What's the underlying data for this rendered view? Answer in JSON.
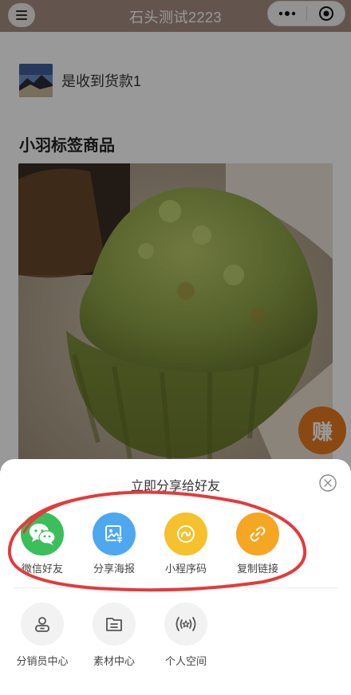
{
  "nav": {
    "title": "石头测试2223",
    "menu_icon": "menu-icon",
    "more_icon": "more-dots-icon",
    "close_icon": "target-close-icon"
  },
  "order": {
    "text": "是收到货款1"
  },
  "product": {
    "title": "小羽标签商品"
  },
  "earn_badge": "赚",
  "share_sheet": {
    "title": "立即分享给好友",
    "share_items": [
      {
        "label": "微信好友",
        "icon": "wechat-icon",
        "color": "#3bbf5a"
      },
      {
        "label": "分享海报",
        "icon": "poster-icon",
        "color": "#4da8f0"
      },
      {
        "label": "小程序码",
        "icon": "mini-program-icon",
        "color": "#f5c12c"
      },
      {
        "label": "复制链接",
        "icon": "link-icon",
        "color": "#f5a623"
      }
    ],
    "tool_items": [
      {
        "label": "分销员中心",
        "icon": "distributor-icon"
      },
      {
        "label": "素材中心",
        "icon": "material-folder-icon"
      },
      {
        "label": "个人空间",
        "icon": "personal-space-icon"
      }
    ]
  },
  "colors": {
    "nav_bg": "#a58e82",
    "annotation": "#e33b3b"
  }
}
